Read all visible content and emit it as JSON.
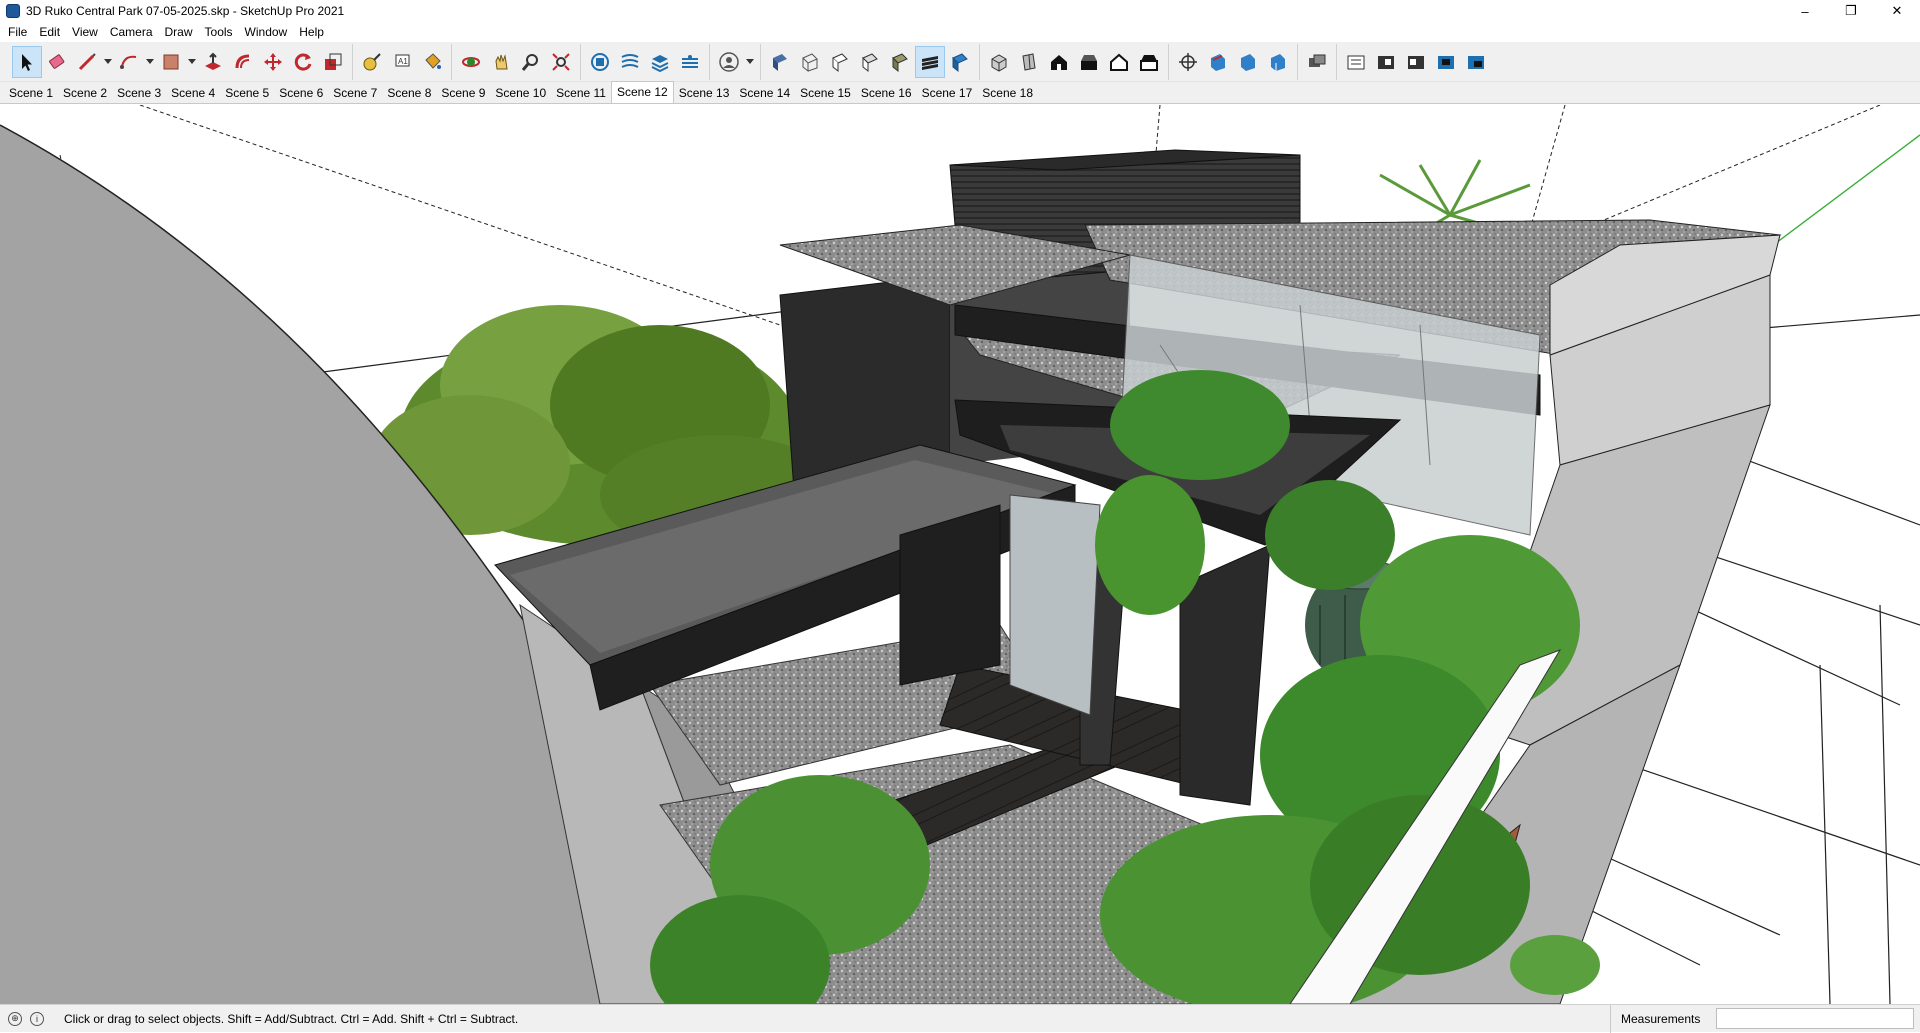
{
  "window": {
    "title": "3D Ruko Central Park 07-05-2025.skp - SketchUp Pro 2021",
    "controls": {
      "minimize": "–",
      "restore": "❐",
      "close": "✕"
    }
  },
  "menu": [
    "File",
    "Edit",
    "View",
    "Camera",
    "Draw",
    "Tools",
    "Window",
    "Help"
  ],
  "toolbar": {
    "groups": [
      [
        "select-tool",
        "eraser-tool",
        "line-tool",
        "line-dropdown",
        "arc-tool",
        "arc-dropdown",
        "rectangle-tool",
        "rectangle-dropdown",
        "push-pull-tool",
        "offset-tool",
        "move-tool",
        "rotate-tool",
        "scale-tool"
      ],
      [
        "tape-measure-tool",
        "text-tool",
        "paint-bucket-tool"
      ],
      [
        "orbit-tool",
        "pan-tool",
        "zoom-tool",
        "zoom-extents-tool"
      ],
      [
        "components-icon",
        "styles-icon",
        "layers-icon",
        "scenes-icon"
      ],
      [
        "account-icon",
        "account-dropdown"
      ],
      [
        "xray-style",
        "wireframe-style",
        "hidden-line-style",
        "shaded-style",
        "textured-style",
        "monochrome-style",
        "back-edges-style"
      ],
      [
        "iso-view",
        "top-view",
        "front-view",
        "right-view",
        "back-view",
        "left-view"
      ],
      [
        "section-plane-tool",
        "section-display-1",
        "section-display-2",
        "section-display-3"
      ],
      [
        "warehouse-icon"
      ],
      [
        "ext-1",
        "ext-2",
        "ext-3",
        "ext-4",
        "ext-5"
      ]
    ],
    "active_tool": "select-tool"
  },
  "scenes": {
    "tabs": [
      "Scene 1",
      "Scene 2",
      "Scene 3",
      "Scene 4",
      "Scene 5",
      "Scene 6",
      "Scene 7",
      "Scene 8",
      "Scene 9",
      "Scene 10",
      "Scene 11",
      "Scene 12",
      "Scene 13",
      "Scene 14",
      "Scene 15",
      "Scene 16",
      "Scene 17",
      "Scene 18"
    ],
    "active": "Scene 12"
  },
  "status": {
    "hint": "Click or drag to select objects. Shift = Add/Subtract. Ctrl = Add. Shift + Ctrl = Subtract.",
    "measurements_label": "Measurements",
    "measurements_value": ""
  },
  "colors": {
    "accent": "#0078d7",
    "concrete": "#8a8a8a",
    "dark_wall": "#2b2b2b",
    "foliage": "#3f7d2a",
    "gravel": "#9a9a9a"
  }
}
